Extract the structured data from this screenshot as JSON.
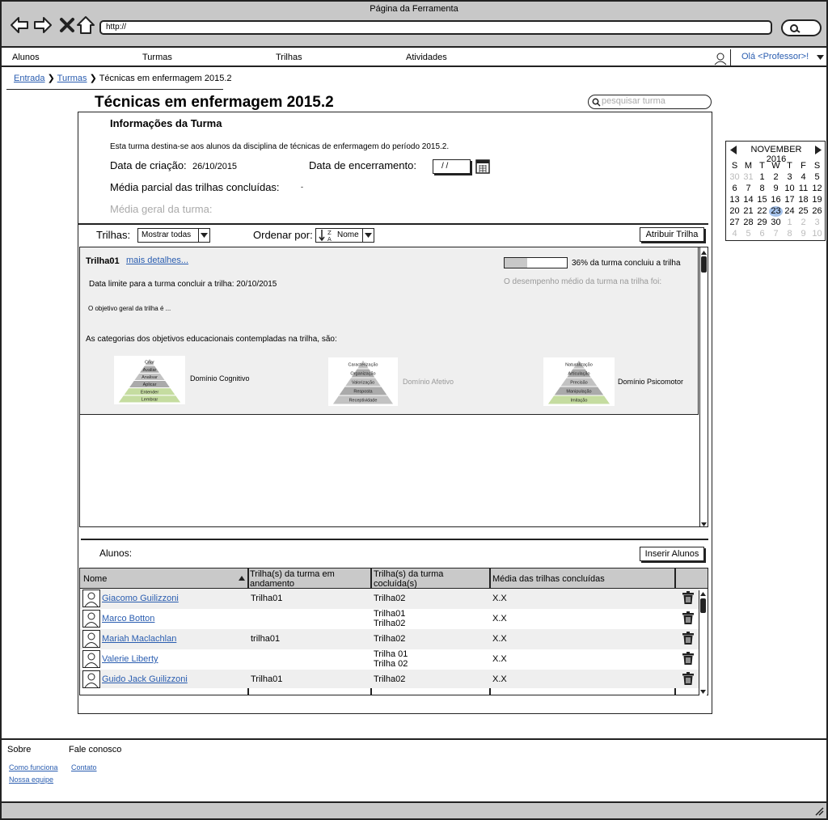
{
  "window": {
    "title": "Página da Ferramenta",
    "url": "http://"
  },
  "menu": {
    "items": [
      "Alunos",
      "Turmas",
      "Trilhas",
      "Atividades"
    ],
    "user_label": "Olá <Professor>!"
  },
  "breadcrumb": {
    "home": "Entrada",
    "turmas": "Turmas",
    "current": "Técnicas em enfermagem 2015.2"
  },
  "page": {
    "title": "Técnicas em enfermagem 2015.2",
    "search_placeholder": "pesquisar turma"
  },
  "info": {
    "heading": "Informações da Turma",
    "description": "Esta turma destina-se aos alunos da disciplina de técnicas de enfermagem do período 2015.2.",
    "creation_label": "Data de criação:",
    "creation_value": "26/10/2015",
    "closing_label": "Data de encerramento:",
    "closing_value": "/ /",
    "partial_avg_label": "Média parcial das trilhas concluídas:",
    "partial_avg_value": "-",
    "overall_avg_label": "Média geral da turma:"
  },
  "trails_bar": {
    "label": "Trilhas:",
    "filter_value": "Mostrar todas",
    "order_label": "Ordenar por:",
    "order_value": "Nome",
    "assign_button": "Atribuir Trilha"
  },
  "trail": {
    "name": "Trilha01",
    "details_link": "mais detalhes...",
    "deadline": "Data limite para a turma concluir a trilha: 20/10/2015",
    "progress": 0.36,
    "progress_text": "36% da turma concluiu a trilha",
    "performance_text": "O desempenho médio da turma na trilha foi:",
    "objective": "O objetivo geral da trilha é ...",
    "categories_text": "As categorias dos objetivos educacionais contempladas na trilha, são:",
    "domains": [
      {
        "name": "Domínio Cognitivo",
        "levels": [
          "Criar",
          "Avaliar",
          "Analisar",
          "Aplicar",
          "Entender",
          "Lembrar"
        ],
        "highlight": [
          4,
          5
        ],
        "dim": false
      },
      {
        "name": "Domínio Afetivo",
        "levels": [
          "Caracterização",
          "Organização",
          "Valorização",
          "Resposta",
          "Receptividade"
        ],
        "highlight": [],
        "dim": true
      },
      {
        "name": "Domínio Psicomotor",
        "levels": [
          "Naturalização",
          "Articulação",
          "Precisão",
          "Manipulação",
          "Imitação"
        ],
        "highlight": [
          4
        ],
        "dim": false
      }
    ]
  },
  "students": {
    "label": "Alunos:",
    "insert_button": "Inserir Alunos",
    "headers": [
      "Nome",
      "Trilha(s) da turma em andamento",
      "Trilha(s) da turma cocluída(s)",
      "Média das trilhas concluídas"
    ],
    "rows": [
      {
        "name": "Giacomo Guilizzoni",
        "ongoing": "Trilha01",
        "done": "Trilha02",
        "avg": "X.X"
      },
      {
        "name": "Marco Botton",
        "ongoing": "",
        "done": "Trilha01\nTrilha02",
        "avg": "X.X"
      },
      {
        "name": "Mariah Maclachlan",
        "ongoing": "trilha01",
        "done": "Trilha02",
        "avg": "X.X"
      },
      {
        "name": "Valerie Liberty",
        "ongoing": "",
        "done": "Trilha 01\nTrilha 02",
        "avg": "X.X"
      },
      {
        "name": "Guido Jack Guilizzoni",
        "ongoing": "Trilha01",
        "done": "Trilha02",
        "avg": "X.X"
      }
    ]
  },
  "calendar": {
    "month": "NOVEMBER 2016",
    "weekdays": [
      "S",
      "M",
      "T",
      "W",
      "T",
      "F",
      "S"
    ],
    "days": [
      "30",
      "31",
      "1",
      "2",
      "3",
      "4",
      "5",
      "6",
      "7",
      "8",
      "9",
      "10",
      "11",
      "12",
      "13",
      "14",
      "15",
      "16",
      "17",
      "18",
      "19",
      "20",
      "21",
      "22",
      "23",
      "24",
      "25",
      "26",
      "27",
      "28",
      "29",
      "30",
      "1",
      "2",
      "3",
      "4",
      "5",
      "6",
      "7",
      "8",
      "9",
      "10"
    ],
    "dim_indexes": [
      0,
      1,
      32,
      33,
      34,
      35,
      36,
      37,
      38,
      39,
      40,
      41
    ],
    "today_index": 24
  },
  "footer": {
    "about": "Sobre",
    "contact_heading": "Fale conosco",
    "how": "Como funciona",
    "team": "Nossa equipe",
    "contact": "Contato"
  }
}
